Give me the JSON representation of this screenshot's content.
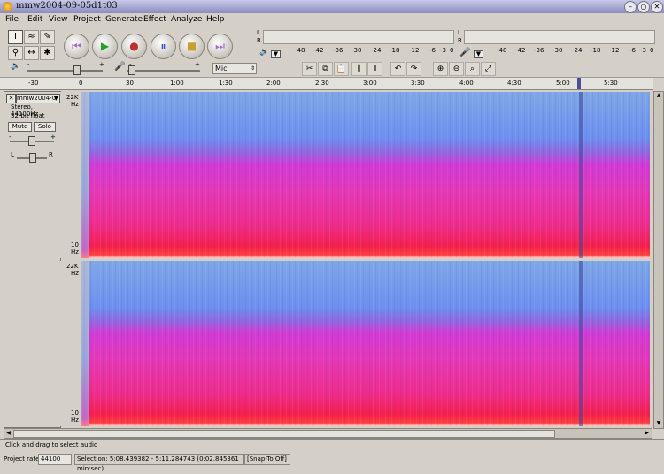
{
  "window": {
    "title": "mmw2004-09-05d1t03"
  },
  "menu": [
    "File",
    "Edit",
    "View",
    "Project",
    "Generate",
    "Effect",
    "Analyze",
    "Help"
  ],
  "meters": {
    "play_channels": [
      "L",
      "R"
    ],
    "rec_channels": [
      "L",
      "R"
    ],
    "play_scale": [
      "-48",
      "-42",
      "-36",
      "-30",
      "-24",
      "-18",
      "-12",
      "-6",
      "-3",
      "0"
    ],
    "rec_scale": [
      "-48",
      "-42",
      "-36",
      "-30",
      "-24",
      "-18",
      "-12",
      "-6",
      "-3",
      "0"
    ]
  },
  "mixer": {
    "minus": "-",
    "plus": "+",
    "input_source": "Mic"
  },
  "ruler": {
    "ticks": [
      "-30",
      "0",
      "30",
      "1:00",
      "1:30",
      "2:00",
      "2:30",
      "3:00",
      "3:30",
      "4:00",
      "4:30",
      "5:00",
      "5:30"
    ]
  },
  "track": {
    "name": "mmw2004-0",
    "format": "Stereo, 44100Hz",
    "sample": "32-bit float",
    "mute": "Mute",
    "solo": "Solo",
    "pan_left": "L",
    "pan_right": "R",
    "gain_minus": "-",
    "gain_plus": "+",
    "freq_top": "22K",
    "freq_bottom": "10",
    "unit": "Hz"
  },
  "status": {
    "message": "Click and drag to select audio"
  },
  "bottom": {
    "project_rate_label": "Project rate:",
    "project_rate": "44100",
    "selection": "Selection: 5:08.439382 - 5:11.284743 (0:02.845361 min:sec)",
    "snap": "[Snap-To Off]"
  }
}
